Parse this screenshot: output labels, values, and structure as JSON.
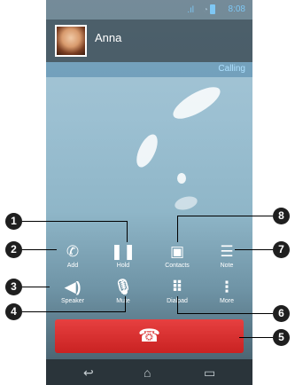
{
  "status_bar": {
    "time": "8:08",
    "signal_icon": "signal-icon",
    "wifi_icon": "wifi-icon",
    "battery_icon": "battery-icon"
  },
  "contact": {
    "name": "Anna"
  },
  "call_status": "Calling",
  "controls": {
    "add": {
      "label": "Add",
      "icon": "add-call-icon"
    },
    "hold": {
      "label": "Hold",
      "icon": "pause-icon"
    },
    "contacts": {
      "label": "Contacts",
      "icon": "contacts-icon"
    },
    "note": {
      "label": "Note",
      "icon": "note-icon"
    },
    "speaker": {
      "label": "Speaker",
      "icon": "speaker-icon"
    },
    "mute": {
      "label": "Mute",
      "icon": "microphone-icon"
    },
    "dialpad": {
      "label": "Dialpad",
      "icon": "dialpad-icon"
    },
    "more": {
      "label": "More",
      "icon": "more-vertical-icon"
    }
  },
  "end_call": {
    "icon": "end-call-icon",
    "color": "#d32b2b"
  },
  "nav": {
    "back_icon": "back-icon",
    "home_icon": "home-icon",
    "recents_icon": "recents-icon"
  },
  "callouts": [
    "1",
    "2",
    "3",
    "4",
    "5",
    "6",
    "7",
    "8"
  ]
}
